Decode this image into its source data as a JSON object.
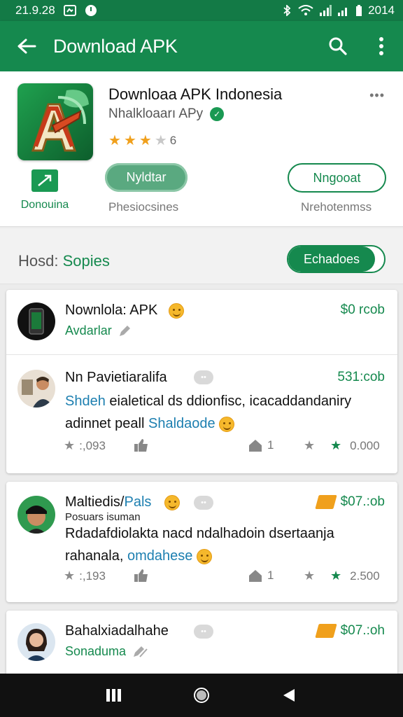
{
  "status": {
    "time": "21.9.28",
    "battery_text": "2014"
  },
  "app_bar": {
    "title": "Download APK",
    "back_icon": "arrow-back-icon",
    "search_icon": "search-icon",
    "menu_icon": "more-vert-icon"
  },
  "app": {
    "name": "Downloaa APK Indonesia",
    "developer": "Nhalkloaarı APy",
    "rating_count": "6",
    "rating_stars": 3,
    "icon_letters": "A",
    "quick_action_label": "Donouina",
    "install_button": "Nyldtar",
    "install_sub": "Phesiocsines",
    "secondary_button": "Nngooat",
    "secondary_sub": "Nrehotenmss"
  },
  "filter": {
    "label_prefix": "Hosd:",
    "label_value": "Sopies",
    "toggle_label": "Echadoes"
  },
  "rows": [
    {
      "name": "Nownlola: APK",
      "sub": "Avdarlar",
      "price": "$0 rcob"
    }
  ],
  "reviews": [
    {
      "name": "Nn Pavietiaralifa",
      "pill": "••",
      "price": "531:cob",
      "line1_hl": "Shdeh",
      "line1": " eialetical ds ddionfisc, icacaddandaniry",
      "line2": "adinnet peall ",
      "line2_hl": "Shaldaode",
      "m1": ":,093",
      "m2": "1",
      "m3": "0.000"
    },
    {
      "name": "Maltiedis/",
      "name_accent": "Pals",
      "pill": "••",
      "price": "$07.:ob",
      "subtitle": "Posuars isuman",
      "line1": "Rdadafdiolakta nacd ndalhadoin dsertaanja",
      "line2": "rahanala, ",
      "line2_hl": "omdahese",
      "m1": ":,193",
      "m2": "1",
      "m3": "2.500"
    },
    {
      "name": "Bahalxiadalhahe",
      "pill": "••",
      "price": "$07.:oh",
      "sub": "Sonaduma"
    }
  ],
  "nav": {
    "recents_icon": "recents-icon",
    "home_icon": "home-icon",
    "back_icon": "back-triangle-icon"
  },
  "colors": {
    "primary": "#15894e",
    "primary_dark": "#137a46",
    "star": "#f0a01c",
    "link": "#1d7fb0"
  }
}
